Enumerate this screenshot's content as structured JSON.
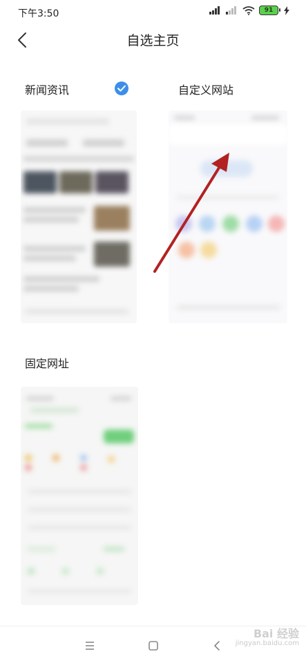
{
  "status": {
    "time": "下午3:50",
    "battery": "91"
  },
  "header": {
    "title": "自选主页"
  },
  "cards": {
    "news": {
      "label": "新闻资讯"
    },
    "custom": {
      "label": "自定义网站"
    },
    "fixed": {
      "label": "固定网址"
    }
  },
  "watermark": {
    "main": "Bai 经验",
    "sub": "jingyan.baidu.com"
  },
  "colors": {
    "accent": "#3c8fe8",
    "arrow": "#b22222"
  },
  "icons": [
    "back-icon",
    "check-icon",
    "menu-icon",
    "home-icon",
    "back-nav-icon",
    "signal-icon",
    "wifi-icon",
    "battery-icon",
    "charging-icon"
  ]
}
